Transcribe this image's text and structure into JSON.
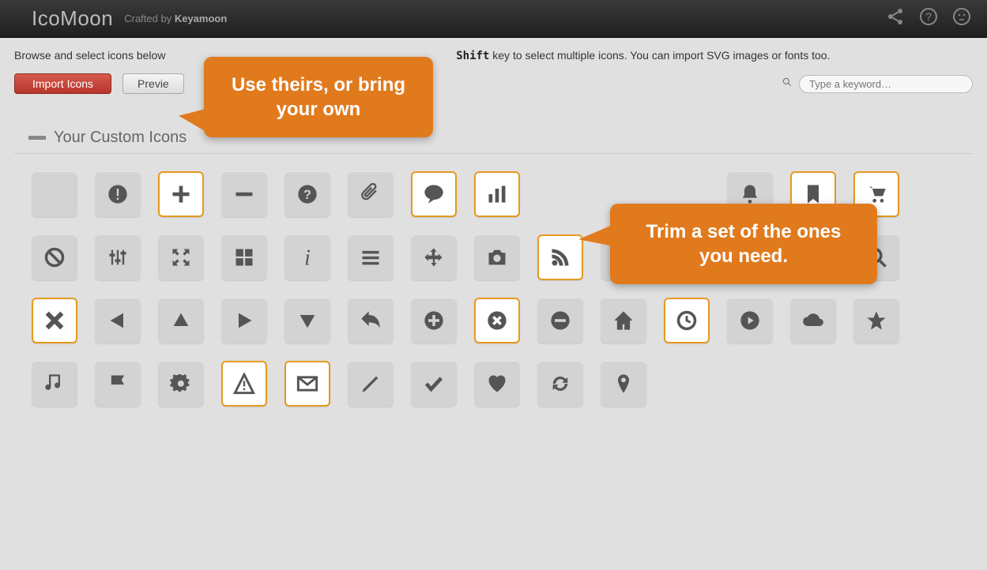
{
  "header": {
    "logo": "IcoMoon",
    "crafted_prefix": "Crafted by ",
    "crafted_name": "Keyamoon"
  },
  "subhead": {
    "part1": "Browse and select icons below",
    "gap": "                                                                  ",
    "kbd": "Shift",
    "part2": " key to select multiple icons. You can import SVG images or fonts too."
  },
  "toolbar": {
    "import": "Import Icons",
    "preview": "Previe",
    "search_placeholder": "Type a keyword…"
  },
  "section": {
    "title": "Your Custom Icons"
  },
  "callouts": {
    "c1": "Use theirs, or bring your own",
    "c2": "Trim a set of the ones you need."
  },
  "icons": [
    {
      "name": "blank",
      "sel": false
    },
    {
      "name": "exclamation-circle-icon",
      "sel": false
    },
    {
      "name": "plus-icon",
      "sel": true
    },
    {
      "name": "minus-icon",
      "sel": false
    },
    {
      "name": "question-circle-icon",
      "sel": false
    },
    {
      "name": "paperclip-icon",
      "sel": false
    },
    {
      "name": "chat-icon",
      "sel": true
    },
    {
      "name": "bar-chart-icon",
      "sel": true
    },
    {
      "name": "hidden-a",
      "sel": false,
      "hidden": true
    },
    {
      "name": "hidden-b",
      "sel": false,
      "hidden": true
    },
    {
      "name": "hidden-c",
      "sel": false,
      "hidden": true
    },
    {
      "name": "bell-icon",
      "sel": false
    },
    {
      "name": "bookmark-icon",
      "sel": true
    },
    {
      "name": "cart-icon",
      "sel": true
    },
    {
      "name": "ban-icon",
      "sel": false
    },
    {
      "name": "sliders-icon",
      "sel": false
    },
    {
      "name": "expand-icon",
      "sel": false
    },
    {
      "name": "grid-icon",
      "sel": false
    },
    {
      "name": "info-icon",
      "sel": false
    },
    {
      "name": "list-icon",
      "sel": false
    },
    {
      "name": "move-icon",
      "sel": false
    },
    {
      "name": "camera-icon",
      "sel": false
    },
    {
      "name": "rss-icon",
      "sel": true
    },
    {
      "name": "share-icon",
      "sel": false
    },
    {
      "name": "tag-icon",
      "sel": false
    },
    {
      "name": "user-icon",
      "sel": false
    },
    {
      "name": "video-icon",
      "sel": false
    },
    {
      "name": "search-icon",
      "sel": false
    },
    {
      "name": "x-icon",
      "sel": true
    },
    {
      "name": "triangle-left-icon",
      "sel": false
    },
    {
      "name": "triangle-up-icon",
      "sel": false
    },
    {
      "name": "triangle-right-icon",
      "sel": false
    },
    {
      "name": "triangle-down-icon",
      "sel": false
    },
    {
      "name": "reply-icon",
      "sel": false
    },
    {
      "name": "plus-circle-icon",
      "sel": false
    },
    {
      "name": "x-circle-icon",
      "sel": true
    },
    {
      "name": "minus-circle-icon",
      "sel": false
    },
    {
      "name": "home-icon",
      "sel": false
    },
    {
      "name": "clock-icon",
      "sel": true
    },
    {
      "name": "play-circle-icon",
      "sel": false
    },
    {
      "name": "cloud-icon",
      "sel": false
    },
    {
      "name": "star-icon",
      "sel": false
    },
    {
      "name": "music-icon",
      "sel": false
    },
    {
      "name": "flag-icon",
      "sel": false
    },
    {
      "name": "gear-icon",
      "sel": false
    },
    {
      "name": "warning-icon",
      "sel": true
    },
    {
      "name": "mail-icon",
      "sel": true
    },
    {
      "name": "pencil-icon",
      "sel": false
    },
    {
      "name": "check-icon",
      "sel": false
    },
    {
      "name": "heart-icon",
      "sel": false
    },
    {
      "name": "refresh-icon",
      "sel": false
    },
    {
      "name": "pin-icon",
      "sel": false
    }
  ]
}
